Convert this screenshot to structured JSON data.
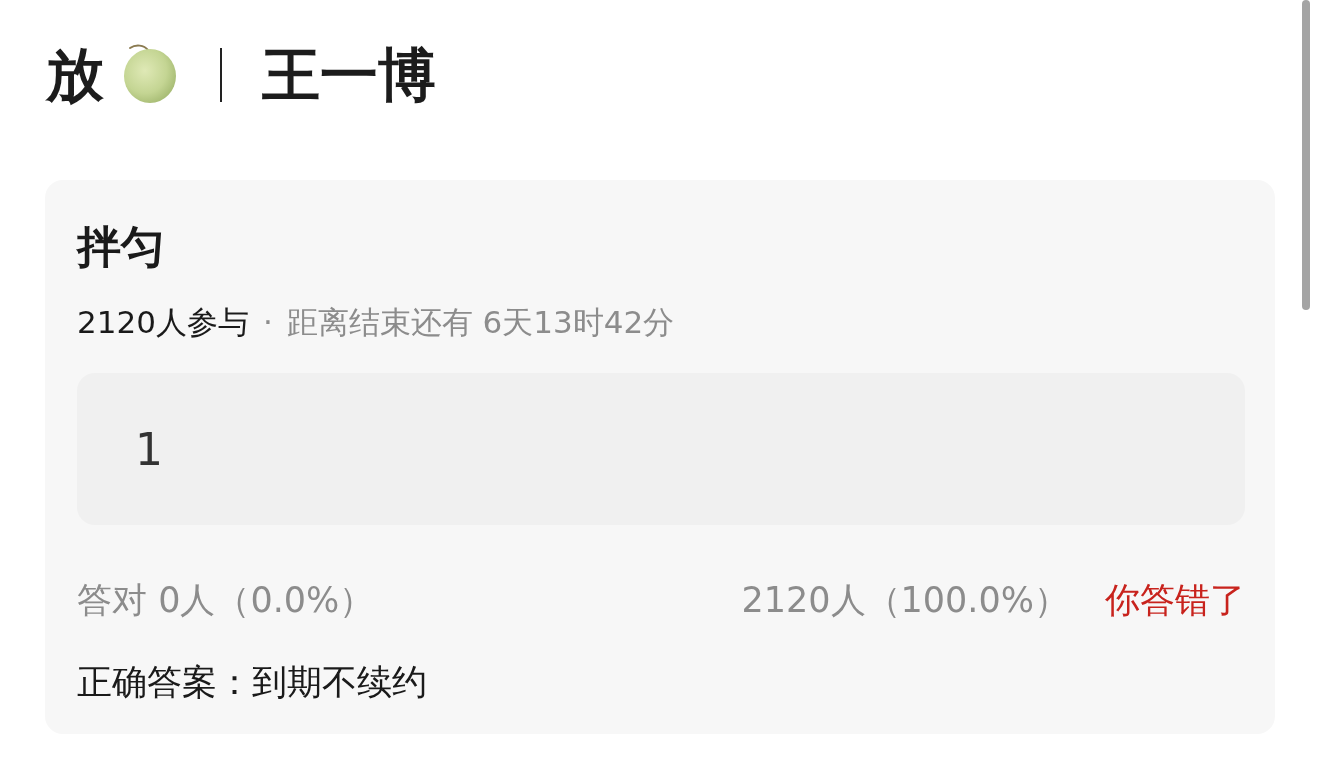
{
  "header": {
    "title_left": "放",
    "title_right": "王一博"
  },
  "quiz": {
    "question": "拌匀",
    "participants": "2120人参与",
    "separator": "·",
    "countdown": "距离结束还有 6天13时42分",
    "answer": "1",
    "correct_stat": "答对 0人（0.0%）",
    "wrong_stat": "2120人（100.0%）",
    "result": {
      "text": "你答错了",
      "correct": false
    },
    "correct_answer": "正确答案：到期不续约"
  }
}
